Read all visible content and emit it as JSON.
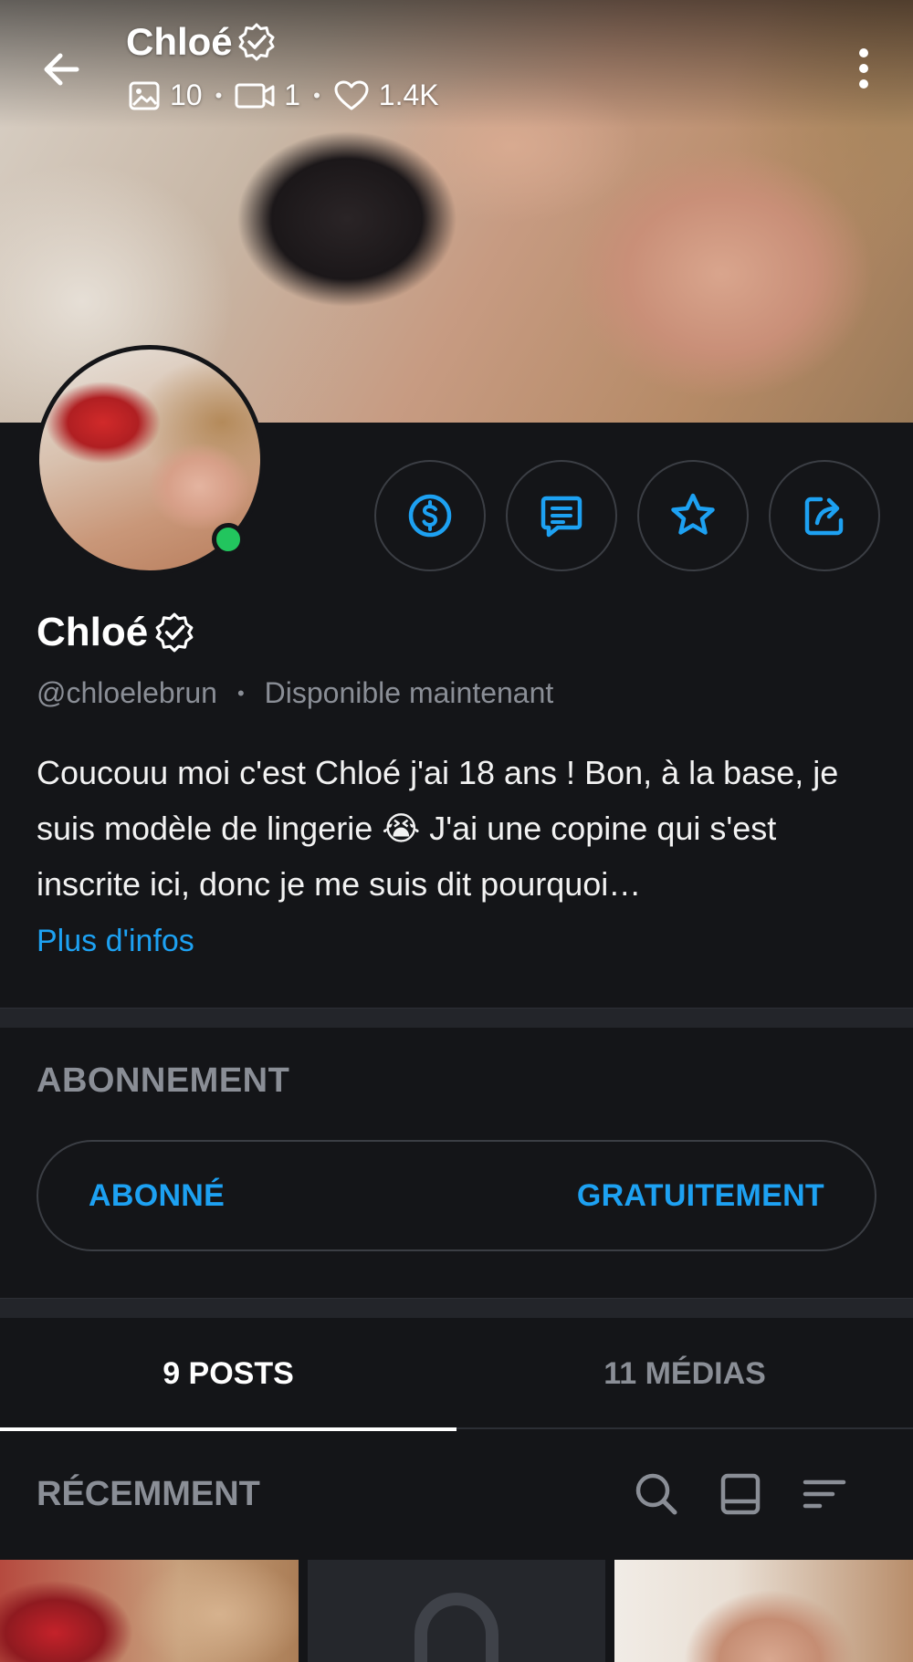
{
  "header": {
    "title": "Chloé",
    "stats": {
      "photos": "10",
      "videos": "1",
      "likes": "1.4K"
    }
  },
  "profile": {
    "name": "Chloé",
    "handle": "@chloelebrun",
    "status": "Disponible maintenant",
    "bio": "Coucouu moi c'est Chloé j'ai 18 ans ! Bon, à la base, je suis modèle de lingerie 😭 J'ai une copine qui s'est inscrite ici, donc je me suis dit pourquoi…",
    "more_info_label": "Plus d'infos",
    "online": true
  },
  "actions": [
    {
      "name": "tip-icon"
    },
    {
      "name": "message-icon"
    },
    {
      "name": "star-icon"
    },
    {
      "name": "share-icon"
    }
  ],
  "subscription": {
    "heading": "ABONNEMENT",
    "status_label": "ABONNÉ",
    "price_label": "GRATUITEMENT"
  },
  "tabs": [
    {
      "label": "9 POSTS",
      "active": true
    },
    {
      "label": "11 MÉDIAS",
      "active": false
    }
  ],
  "recent": {
    "heading": "RÉCEMMENT"
  },
  "colors": {
    "background": "#141518",
    "accent": "#1da1f2",
    "online": "#22c55e",
    "muted_text": "#8a8e96"
  }
}
